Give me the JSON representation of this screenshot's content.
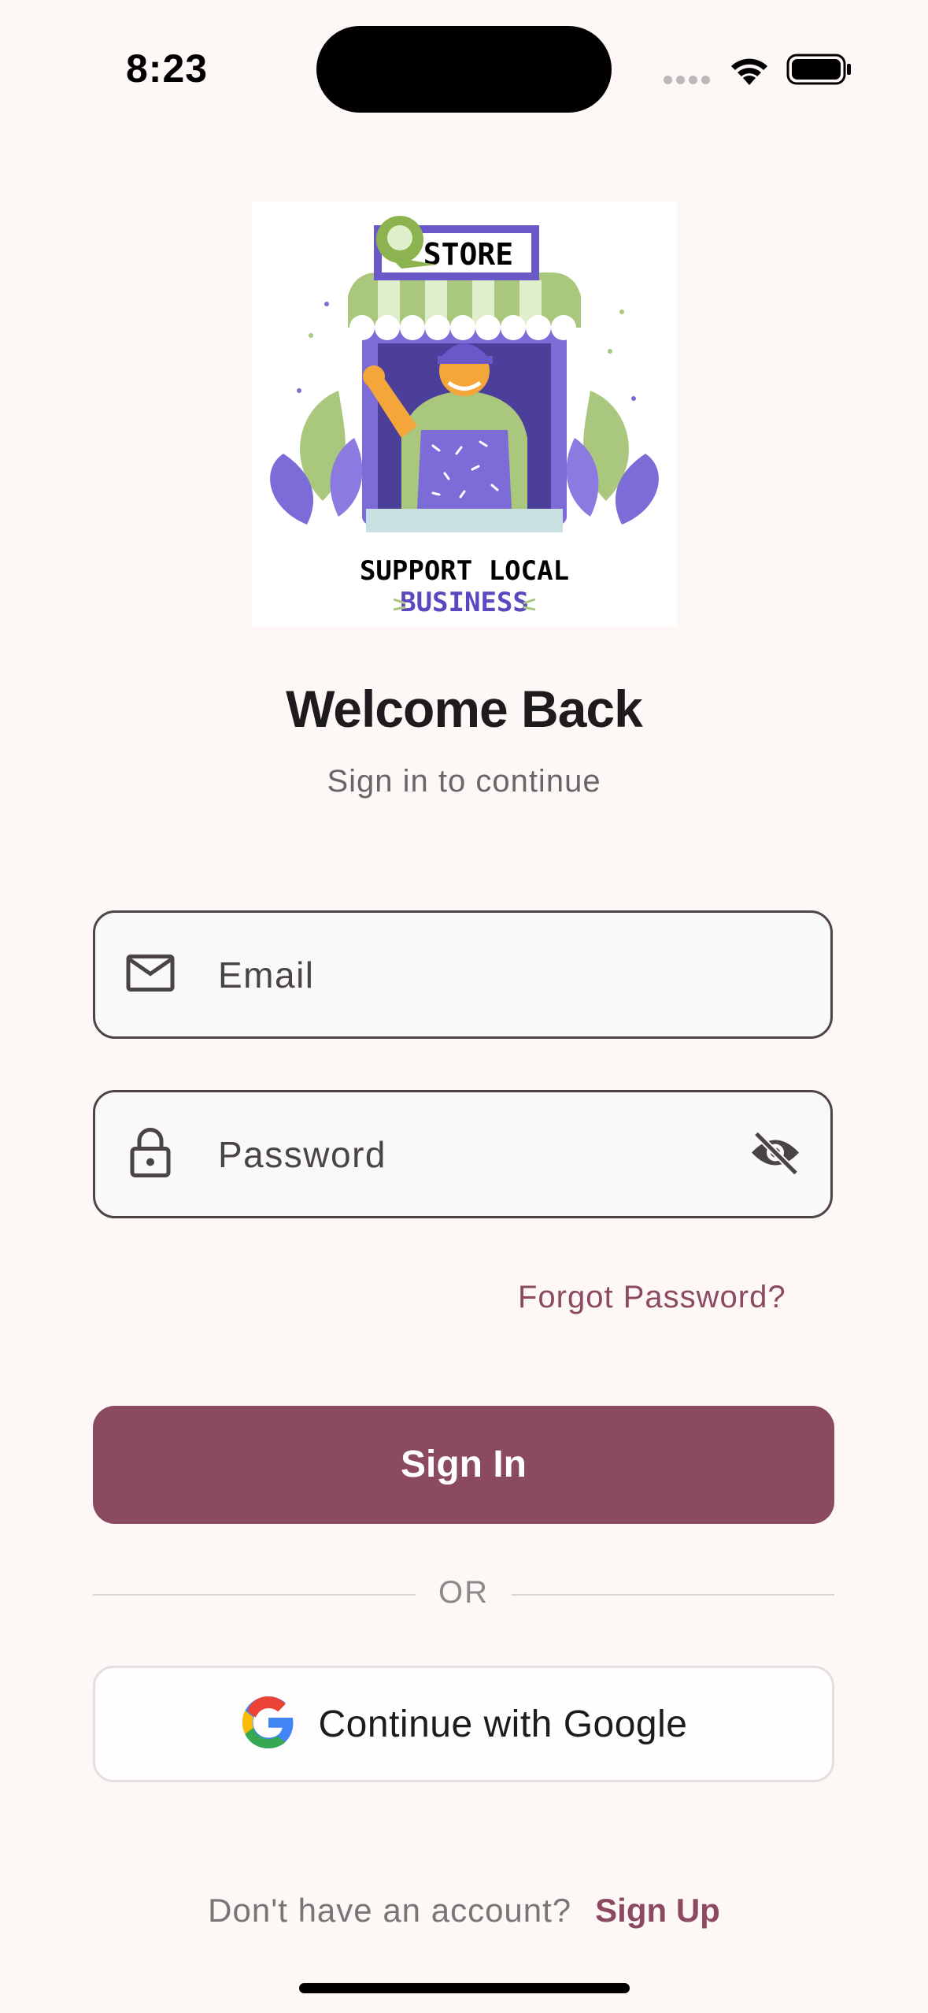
{
  "status_bar": {
    "time": "8:23"
  },
  "logo": {
    "store_text": "STORE",
    "tagline_line1": "SUPPORT LOCAL",
    "tagline_line2": "BUSINESS"
  },
  "header": {
    "title": "Welcome Back",
    "subtitle": "Sign in to continue"
  },
  "form": {
    "email_placeholder": "Email",
    "password_placeholder": "Password",
    "forgot_password": "Forgot Password?",
    "sign_in": "Sign In"
  },
  "divider": {
    "text": "OR"
  },
  "google": {
    "label": "Continue with Google"
  },
  "footer": {
    "prompt": "Don't have an account?",
    "sign_up": "Sign Up"
  },
  "colors": {
    "accent": "#8b4a60",
    "background": "#fdf7f6",
    "field_border": "#4e4448"
  }
}
